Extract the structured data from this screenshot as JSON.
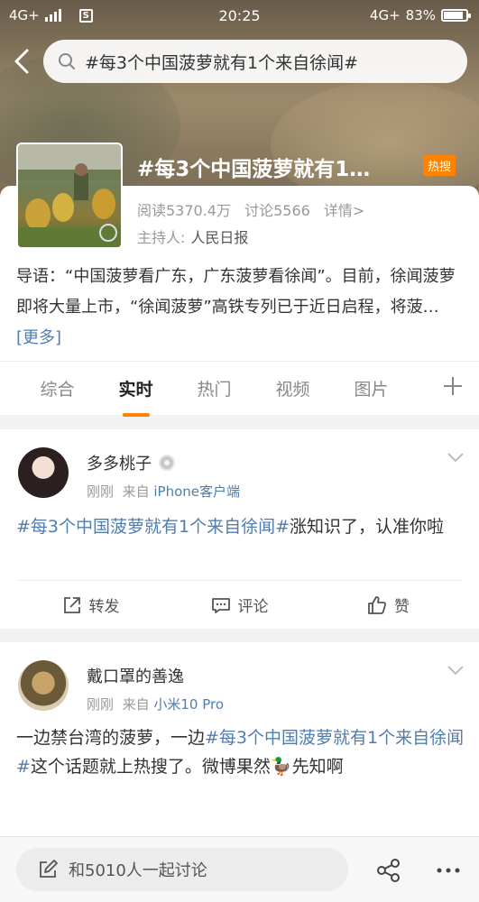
{
  "status_bar": {
    "network_left": "4G+",
    "time": "20:25",
    "network_right": "4G+",
    "battery": "83%",
    "battery_level": 0.83
  },
  "search": {
    "query": "#每3个中国菠萝就有1个来自徐闻#"
  },
  "topic": {
    "title": "#每3个中国菠萝就有1…",
    "hot_badge": "热搜",
    "reads": "阅读5370.4万",
    "discussions": "讨论5566",
    "details": "详情>",
    "host_label": "主持人:",
    "host_name": "人民日报",
    "intro": "导语：“中国菠萝看广东，广东菠萝看徐闻”。目前，徐闻菠萝即将大量上市，“徐闻菠萝”高铁专列已于近日启程，将菠…",
    "more": "[更多]"
  },
  "tabs": [
    {
      "label": "综合",
      "active": false
    },
    {
      "label": "实时",
      "active": true
    },
    {
      "label": "热门",
      "active": false
    },
    {
      "label": "视频",
      "active": false
    },
    {
      "label": "图片",
      "active": false
    }
  ],
  "posts": [
    {
      "username": "多多桃子",
      "time": "刚刚",
      "from_label": "来自",
      "source": "iPhone客户端",
      "hashtag": "#每3个中国菠萝就有1个来自徐闻#",
      "text_after": "涨知识了，认准你啦",
      "actions": {
        "repost": "转发",
        "comment": "评论",
        "like": "赞"
      }
    },
    {
      "username": "戴口罩的善逸",
      "time": "刚刚",
      "from_label": "来自",
      "source": "小米10 Pro",
      "text_before": "一边禁台湾的菠萝，一边",
      "hashtag": "#每3个中国菠萝就有1个来自徐闻#",
      "text_after": "这个话题就上热搜了。微博果然🦆先知啊"
    }
  ],
  "bottom_bar": {
    "discuss_placeholder": "和5010人一起讨论"
  },
  "colors": {
    "accent": "#ff8200",
    "link": "#507daf"
  }
}
